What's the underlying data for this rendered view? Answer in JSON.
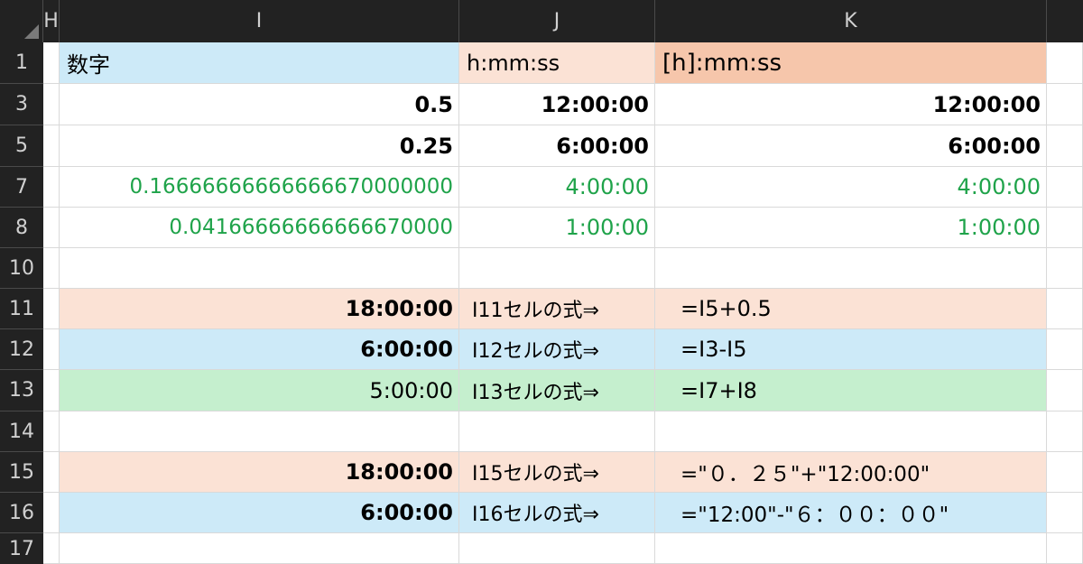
{
  "columns": {
    "h": "H",
    "i": "I",
    "j": "J",
    "k": "K"
  },
  "rows": {
    "r1": {
      "num": "1",
      "i": "数字",
      "j": "h:mm:ss",
      "k": "[h]:mm:ss"
    },
    "r3": {
      "num": "3",
      "i": "0.5",
      "j": "12:00:00",
      "k": "12:00:00"
    },
    "r5": {
      "num": "5",
      "i": "0.25",
      "j": "6:00:00",
      "k": "6:00:00"
    },
    "r7": {
      "num": "7",
      "i": "0.16666666666666670000000",
      "j": "4:00:00",
      "k": "4:00:00"
    },
    "r8": {
      "num": "8",
      "i": "0.04166666666666670000",
      "j": "1:00:00",
      "k": "1:00:00"
    },
    "r10": {
      "num": "10"
    },
    "r11": {
      "num": "11",
      "i": "18:00:00",
      "j": "I11セルの式⇒",
      "k": "=I5+0.5"
    },
    "r12": {
      "num": "12",
      "i": "6:00:00",
      "j": "I12セルの式⇒",
      "k": "=I3-I5"
    },
    "r13": {
      "num": "13",
      "i": "5:00:00",
      "j": "I13セルの式⇒",
      "k": "=I7+I8"
    },
    "r14": {
      "num": "14"
    },
    "r15": {
      "num": "15",
      "i": "18:00:00",
      "j": "I15セルの式⇒",
      "k": "=\"０．２５\"+\"12:00:00\""
    },
    "r16": {
      "num": "16",
      "i": "6:00:00",
      "j": "I16セルの式⇒",
      "k": "=\"12:00\"-\"６：００：００\""
    },
    "r17": {
      "num": "17"
    }
  },
  "colors": {
    "header_bg": "#222222",
    "blue_fill": "#cdeaf8",
    "peach_fill": "#fbe2d5",
    "salmon_fill": "#f6c6ab",
    "green_fill": "#c5efce",
    "green_text": "#1fa34a"
  }
}
